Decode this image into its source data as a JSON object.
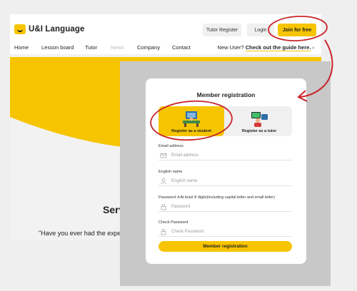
{
  "site": {
    "logo_text": "U&I Language",
    "header_buttons": {
      "tutor_register": "Tutor Register",
      "login": "Login",
      "join": "Join for free"
    },
    "nav": [
      "Home",
      "Lesson board",
      "Tutor",
      "News",
      "Company",
      "Contact"
    ],
    "guide_prefix": "New User? ",
    "guide_link": "Check out the guide here.",
    "guide_arrow": "›",
    "section_heading_partial": "Serv",
    "quote_partial": "\"Have you ever had the exper"
  },
  "modal": {
    "title": "Member registration",
    "tab_student": "Register as a student",
    "tab_tutor": "Register as a tutor",
    "fields": [
      {
        "label": "Email address",
        "placeholder": "Email address",
        "icon": "mail-icon"
      },
      {
        "label": "English name",
        "placeholder": "English name",
        "icon": "user-icon"
      },
      {
        "label": "Password ※At least 8 digits(including capital letter and small letter)",
        "placeholder": "Password",
        "icon": "lock-icon"
      },
      {
        "label": "Check Password",
        "placeholder": "Check Password",
        "icon": "lock-icon"
      }
    ],
    "submit": "Member registration"
  },
  "colors": {
    "accent": "#f6c500",
    "annotation": "#c8242b",
    "overlay": "#c8c8c8"
  }
}
